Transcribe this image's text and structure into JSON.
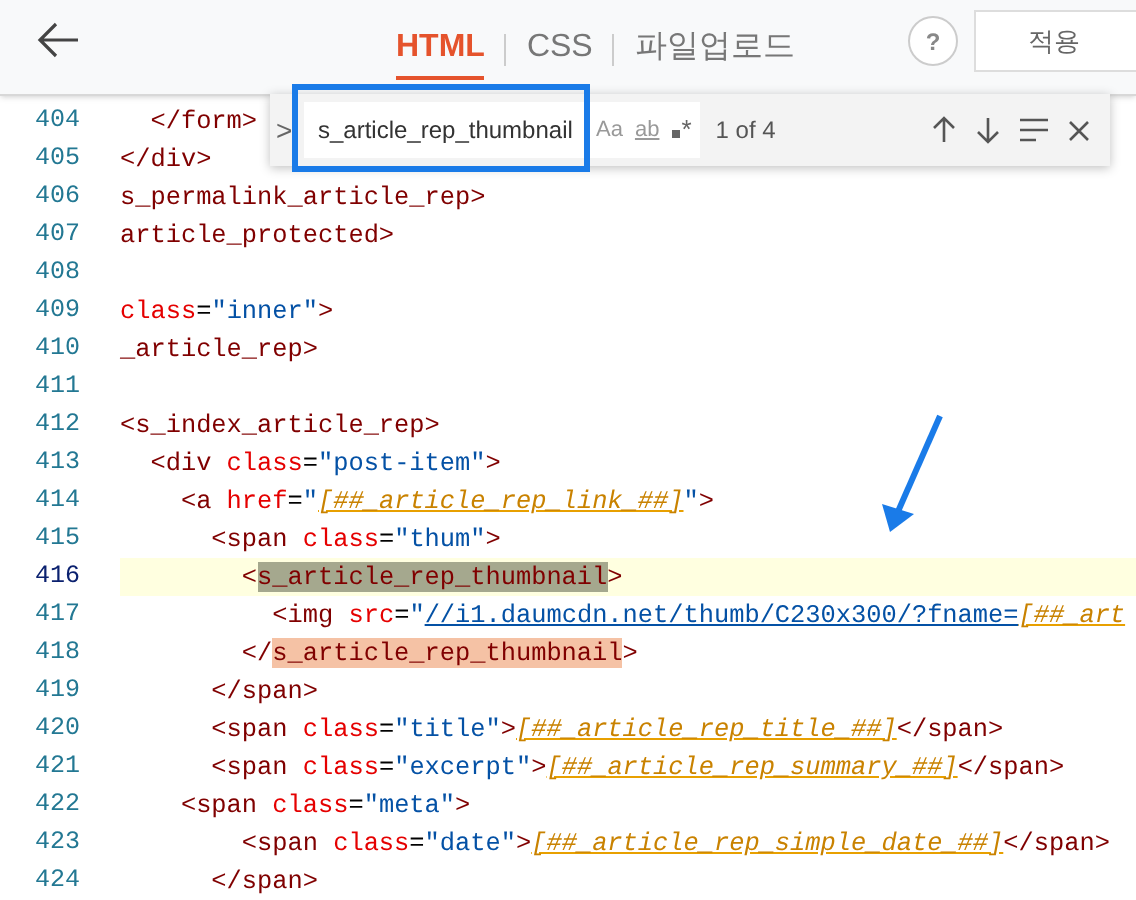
{
  "header": {
    "tabs": [
      {
        "label": "HTML",
        "selected": true
      },
      {
        "label": "CSS",
        "selected": false
      },
      {
        "label": "파일업로드",
        "selected": false
      }
    ],
    "help": "?",
    "apply": "적용"
  },
  "find": {
    "toggle": ">",
    "query": "s_article_rep_thumbnail",
    "options": [
      "Aa",
      "ab",
      "*"
    ],
    "count": "1 of 4"
  },
  "lines": [
    {
      "number": "404",
      "current": false,
      "tokens": [
        {
          "kind": "tag",
          "text": "  </form>"
        }
      ]
    },
    {
      "number": "405",
      "current": false,
      "tokens": [
        {
          "kind": "tag",
          "text": "</div>"
        }
      ]
    },
    {
      "number": "406",
      "current": false,
      "tokens": [
        {
          "kind": "tag",
          "text": "s_permalink_article_rep>"
        }
      ]
    },
    {
      "number": "407",
      "current": false,
      "tokens": [
        {
          "kind": "tag",
          "text": "article_protected>"
        }
      ]
    },
    {
      "number": "408",
      "current": false
    },
    {
      "number": "409",
      "current": false,
      "tokens": [
        {
          "kind": "attr",
          "text": "class"
        },
        {
          "kind": "op",
          "text": "="
        },
        {
          "kind": "str",
          "text": "\"inner\""
        },
        {
          "kind": "tag",
          "text": ">"
        }
      ]
    },
    {
      "number": "410",
      "current": false,
      "tokens": [
        {
          "kind": "tag",
          "text": "_article_rep>"
        }
      ]
    },
    {
      "number": "411",
      "current": false
    },
    {
      "number": "412",
      "current": false,
      "tokens": [
        {
          "kind": "tag",
          "text": "<s_index_article_rep>"
        }
      ]
    },
    {
      "number": "413",
      "current": false,
      "tokens": [
        {
          "kind": "tag",
          "text": "  <div "
        },
        {
          "kind": "attr",
          "text": "class"
        },
        {
          "kind": "op",
          "text": "="
        },
        {
          "kind": "str",
          "text": "\"post-item\""
        },
        {
          "kind": "tag",
          "text": ">"
        }
      ]
    },
    {
      "number": "414",
      "current": false,
      "tokens": [
        {
          "kind": "tag",
          "text": "    <a "
        },
        {
          "kind": "attr",
          "text": "href"
        },
        {
          "kind": "op",
          "text": "="
        },
        {
          "kind": "str",
          "text": "\""
        },
        {
          "kind": "tmpl",
          "text": "[##_article_rep_link_##]"
        },
        {
          "kind": "str",
          "text": "\""
        },
        {
          "kind": "tag",
          "text": ">"
        }
      ]
    },
    {
      "number": "415",
      "current": false,
      "tokens": [
        {
          "kind": "tag",
          "text": "      <span "
        },
        {
          "kind": "attr",
          "text": "class"
        },
        {
          "kind": "op",
          "text": "="
        },
        {
          "kind": "str",
          "text": "\"thum\""
        },
        {
          "kind": "tag",
          "text": ">"
        }
      ]
    },
    {
      "number": "416",
      "current": true,
      "tokens": [
        {
          "kind": "tag",
          "text": "        <"
        },
        {
          "kind": "current_match",
          "text": "s_article_rep_thumbnail"
        },
        {
          "kind": "tag",
          "text": ">"
        }
      ]
    },
    {
      "number": "417",
      "current": false,
      "tokens": [
        {
          "kind": "tag",
          "text": "          <img "
        },
        {
          "kind": "attr",
          "text": "src"
        },
        {
          "kind": "op",
          "text": "="
        },
        {
          "kind": "str",
          "text": "\""
        },
        {
          "kind": "link",
          "text": "//i1.daumcdn.net/thumb/C230x300/?fname="
        },
        {
          "kind": "tmpl",
          "text": "[##_art"
        }
      ]
    },
    {
      "number": "418",
      "current": false,
      "tokens": [
        {
          "kind": "tag",
          "text": "        </"
        },
        {
          "kind": "match",
          "text": "s_article_rep_thumbnail"
        },
        {
          "kind": "tag",
          "text": ">"
        }
      ]
    },
    {
      "number": "419",
      "current": false,
      "tokens": [
        {
          "kind": "tag",
          "text": "      </span>"
        }
      ]
    },
    {
      "number": "420",
      "current": false,
      "tokens": [
        {
          "kind": "tag",
          "text": "      <span "
        },
        {
          "kind": "attr",
          "text": "class"
        },
        {
          "kind": "op",
          "text": "="
        },
        {
          "kind": "str",
          "text": "\"title\""
        },
        {
          "kind": "tag",
          "text": ">"
        },
        {
          "kind": "tmpl",
          "text": "[##_article_rep_title_##]"
        },
        {
          "kind": "tag",
          "text": "</span>"
        }
      ]
    },
    {
      "number": "421",
      "current": false,
      "tokens": [
        {
          "kind": "tag",
          "text": "      <span "
        },
        {
          "kind": "attr",
          "text": "class"
        },
        {
          "kind": "op",
          "text": "="
        },
        {
          "kind": "str",
          "text": "\"excerpt\""
        },
        {
          "kind": "tag",
          "text": ">"
        },
        {
          "kind": "tmpl",
          "text": "[##_article_rep_summary_##]"
        },
        {
          "kind": "tag",
          "text": "</span>"
        }
      ]
    },
    {
      "number": "422",
      "current": false,
      "tokens": [
        {
          "kind": "tag",
          "text": "    <span "
        },
        {
          "kind": "attr",
          "text": "class"
        },
        {
          "kind": "op",
          "text": "="
        },
        {
          "kind": "str",
          "text": "\"meta\""
        },
        {
          "kind": "tag",
          "text": ">"
        }
      ]
    },
    {
      "number": "423",
      "current": false,
      "tokens": [
        {
          "kind": "tag",
          "text": "        <span "
        },
        {
          "kind": "attr",
          "text": "class"
        },
        {
          "kind": "op",
          "text": "="
        },
        {
          "kind": "str",
          "text": "\"date\""
        },
        {
          "kind": "tag",
          "text": ">"
        },
        {
          "kind": "tmpl",
          "text": "[##_article_rep_simple_date_##]"
        },
        {
          "kind": "tag",
          "text": "</span>"
        }
      ]
    },
    {
      "number": "424",
      "current": false,
      "tokens": [
        {
          "kind": "tag",
          "text": "      </span>"
        }
      ]
    }
  ]
}
